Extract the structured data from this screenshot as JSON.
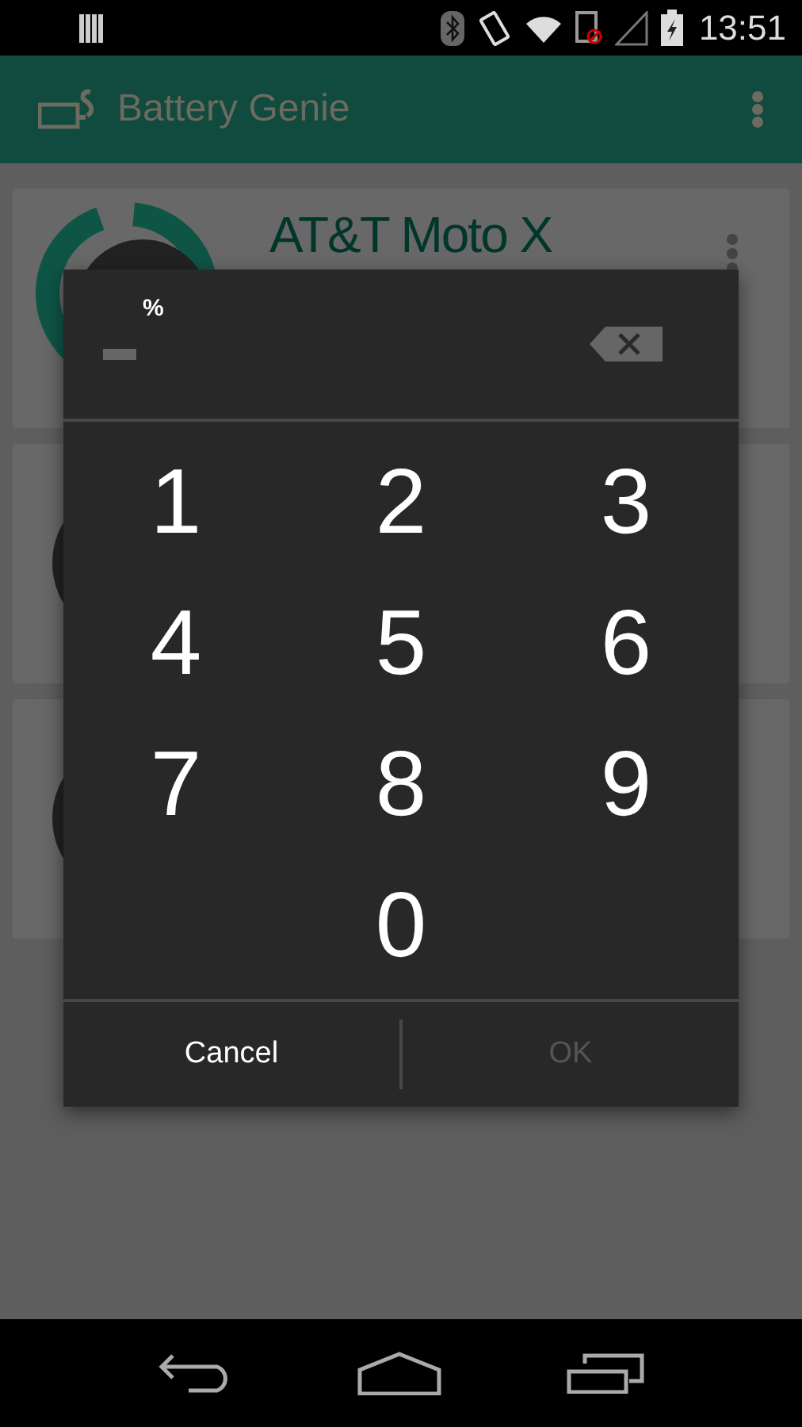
{
  "status_bar": {
    "time": "13:51"
  },
  "app_bar": {
    "title": "Battery Genie"
  },
  "device_cards": [
    {
      "kind": "device",
      "name": "AT&T Moto X"
    },
    {
      "kind": "covered"
    },
    {
      "kind": "covered"
    }
  ],
  "number_dialog": {
    "unit": "%",
    "keys": [
      "1",
      "2",
      "3",
      "4",
      "5",
      "6",
      "7",
      "8",
      "9",
      "0"
    ],
    "buttons": [
      {
        "label": "Cancel",
        "disabled": false
      },
      {
        "label": "OK",
        "disabled": true
      }
    ]
  }
}
